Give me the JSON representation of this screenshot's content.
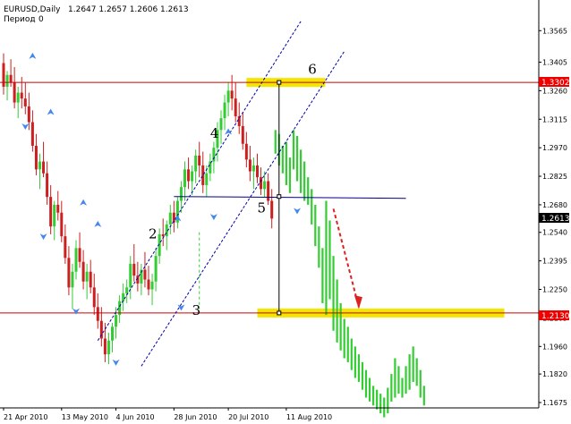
{
  "window": {
    "symbol_title": "EURUSD,Daily",
    "ohlc": "1.2647 1.2657 1.2606 1.2613",
    "indicator_label": "Период",
    "indicator_value": "0"
  },
  "colors": {
    "background": "#ffffff",
    "bull": "#33cc33",
    "bear": "#cc1f1f",
    "projection": "#33cc33",
    "resistance_line": "#cc0000",
    "horizontal_line": "#000080",
    "channel": "#0000aa",
    "target_zone": "#f5e600",
    "arrow_dashed": "#dd2222",
    "fractal_arrow": "#4488ee",
    "price_tag_red": "#ee0000",
    "price_tag_black": "#000000"
  },
  "chart_data": {
    "type": "candlestick",
    "symbol": "EURUSD",
    "timeframe": "Daily",
    "ylim": [
      1.1675,
      1.3639
    ],
    "y_ticks": [
      "1.3565",
      "1.3405",
      "1.3260",
      "1.3115",
      "1.2970",
      "1.2825",
      "1.2680",
      "1.2540",
      "1.2395",
      "1.2250",
      "1.2105",
      "1.1960",
      "1.1820",
      "1.1675"
    ],
    "x_ticks": [
      "21 Apr 2010",
      "13 May 2010",
      "4 Jun 2010",
      "28 Jun 2010",
      "20 Jul 2010",
      "11 Aug 2010"
    ],
    "candles": [
      [
        1.34,
        1.345,
        1.324,
        1.328
      ],
      [
        1.328,
        1.336,
        1.321,
        1.334
      ],
      [
        1.334,
        1.342,
        1.328,
        1.33
      ],
      [
        1.33,
        1.338,
        1.317,
        1.32
      ],
      [
        1.32,
        1.328,
        1.312,
        1.325
      ],
      [
        1.325,
        1.333,
        1.317,
        1.322
      ],
      [
        1.322,
        1.33,
        1.314,
        1.318
      ],
      [
        1.318,
        1.325,
        1.306,
        1.31
      ],
      [
        1.31,
        1.316,
        1.295,
        1.298
      ],
      [
        1.298,
        1.304,
        1.283,
        1.286
      ],
      [
        1.286,
        1.294,
        1.276,
        1.29
      ],
      [
        1.29,
        1.3,
        1.282,
        1.284
      ],
      [
        1.284,
        1.29,
        1.268,
        1.272
      ],
      [
        1.272,
        1.278,
        1.253,
        1.257
      ],
      [
        1.257,
        1.27,
        1.25,
        1.268
      ],
      [
        1.268,
        1.275,
        1.26,
        1.264
      ],
      [
        1.264,
        1.27,
        1.249,
        1.252
      ],
      [
        1.252,
        1.258,
        1.238,
        1.241
      ],
      [
        1.241,
        1.247,
        1.222,
        1.226
      ],
      [
        1.226,
        1.238,
        1.215,
        1.234
      ],
      [
        1.234,
        1.25,
        1.23,
        1.246
      ],
      [
        1.246,
        1.254,
        1.236,
        1.239
      ],
      [
        1.239,
        1.245,
        1.225,
        1.229
      ],
      [
        1.229,
        1.238,
        1.22,
        1.234
      ],
      [
        1.234,
        1.24,
        1.223,
        1.226
      ],
      [
        1.226,
        1.233,
        1.212,
        1.216
      ],
      [
        1.216,
        1.223,
        1.205,
        1.209
      ],
      [
        1.209,
        1.216,
        1.196,
        1.2
      ],
      [
        1.2,
        1.208,
        1.188,
        1.192
      ],
      [
        1.192,
        1.203,
        1.187,
        1.199
      ],
      [
        1.199,
        1.208,
        1.193,
        1.206
      ],
      [
        1.206,
        1.216,
        1.2,
        1.212
      ],
      [
        1.212,
        1.222,
        1.208,
        1.219
      ],
      [
        1.219,
        1.228,
        1.214,
        1.223
      ],
      [
        1.223,
        1.23,
        1.218,
        1.226
      ],
      [
        1.226,
        1.242,
        1.22,
        1.238
      ],
      [
        1.238,
        1.248,
        1.229,
        1.232
      ],
      [
        1.232,
        1.239,
        1.224,
        1.228
      ],
      [
        1.228,
        1.238,
        1.222,
        1.235
      ],
      [
        1.235,
        1.244,
        1.226,
        1.23
      ],
      [
        1.23,
        1.237,
        1.222,
        1.225
      ],
      [
        1.225,
        1.233,
        1.217,
        1.229
      ],
      [
        1.229,
        1.246,
        1.224,
        1.242
      ],
      [
        1.242,
        1.256,
        1.238,
        1.253
      ],
      [
        1.253,
        1.261,
        1.247,
        1.252
      ],
      [
        1.252,
        1.26,
        1.245,
        1.258
      ],
      [
        1.258,
        1.268,
        1.253,
        1.264
      ],
      [
        1.264,
        1.27,
        1.254,
        1.259
      ],
      [
        1.259,
        1.272,
        1.256,
        1.27
      ],
      [
        1.27,
        1.28,
        1.264,
        1.277
      ],
      [
        1.277,
        1.29,
        1.27,
        1.286
      ],
      [
        1.286,
        1.292,
        1.276,
        1.28
      ],
      [
        1.28,
        1.288,
        1.273,
        1.285
      ],
      [
        1.285,
        1.296,
        1.279,
        1.293
      ],
      [
        1.293,
        1.3,
        1.282,
        1.288
      ],
      [
        1.288,
        1.295,
        1.274,
        1.278
      ],
      [
        1.278,
        1.288,
        1.272,
        1.284
      ],
      [
        1.284,
        1.294,
        1.28,
        1.29
      ],
      [
        1.29,
        1.3,
        1.284,
        1.297
      ],
      [
        1.297,
        1.31,
        1.29,
        1.306
      ],
      [
        1.306,
        1.316,
        1.299,
        1.312
      ],
      [
        1.312,
        1.324,
        1.306,
        1.32
      ],
      [
        1.32,
        1.33,
        1.313,
        1.326
      ],
      [
        1.326,
        1.334,
        1.316,
        1.322
      ],
      [
        1.322,
        1.33,
        1.31,
        1.313
      ],
      [
        1.313,
        1.32,
        1.304,
        1.308
      ],
      [
        1.308,
        1.315,
        1.296,
        1.299
      ],
      [
        1.299,
        1.305,
        1.287,
        1.291
      ],
      [
        1.291,
        1.298,
        1.28,
        1.285
      ],
      [
        1.285,
        1.292,
        1.276,
        1.288
      ],
      [
        1.288,
        1.294,
        1.279,
        1.282
      ],
      [
        1.282,
        1.287,
        1.273,
        1.276
      ],
      [
        1.276,
        1.285,
        1.272,
        1.28
      ],
      [
        1.28,
        1.284,
        1.268,
        1.27
      ],
      [
        1.27,
        1.276,
        1.256,
        1.261
      ]
    ],
    "projection": [
      [
        1.306,
        1.294
      ],
      [
        1.304,
        1.288
      ],
      [
        1.298,
        1.284
      ],
      [
        1.3,
        1.278
      ],
      [
        1.292,
        1.274
      ],
      [
        1.306,
        1.286
      ],
      [
        1.303,
        1.28
      ],
      [
        1.296,
        1.274
      ],
      [
        1.29,
        1.27
      ],
      [
        1.282,
        1.268
      ],
      [
        1.276,
        1.258
      ],
      [
        1.268,
        1.247
      ],
      [
        1.257,
        1.236
      ],
      [
        1.246,
        1.218
      ],
      [
        1.27,
        1.212
      ],
      [
        1.26,
        1.22
      ],
      [
        1.242,
        1.204
      ],
      [
        1.23,
        1.198
      ],
      [
        1.218,
        1.194
      ],
      [
        1.21,
        1.19
      ],
      [
        1.206,
        1.188
      ],
      [
        1.2,
        1.184
      ],
      [
        1.196,
        1.18
      ],
      [
        1.192,
        1.178
      ],
      [
        1.188,
        1.174
      ],
      [
        1.184,
        1.17
      ],
      [
        1.18,
        1.168
      ],
      [
        1.176,
        1.166
      ],
      [
        1.174,
        1.164
      ],
      [
        1.172,
        1.162
      ],
      [
        1.17,
        1.16
      ],
      [
        1.175,
        1.162
      ],
      [
        1.182,
        1.168
      ],
      [
        1.19,
        1.17
      ],
      [
        1.186,
        1.172
      ],
      [
        1.18,
        1.17
      ],
      [
        1.186,
        1.172
      ],
      [
        1.192,
        1.174
      ],
      [
        1.196,
        1.178
      ],
      [
        1.19,
        1.176
      ],
      [
        1.184,
        1.17
      ],
      [
        1.176,
        1.166
      ]
    ],
    "resistance_level": 1.3302,
    "support_level": 1.213,
    "current_price": 1.2613,
    "neckline_level": 1.2722,
    "annotations": [
      "2",
      "3",
      "4",
      "5",
      "6"
    ]
  },
  "price_tags": {
    "resistance": "1.3302",
    "support": "1.2130",
    "current": "1.2613"
  }
}
